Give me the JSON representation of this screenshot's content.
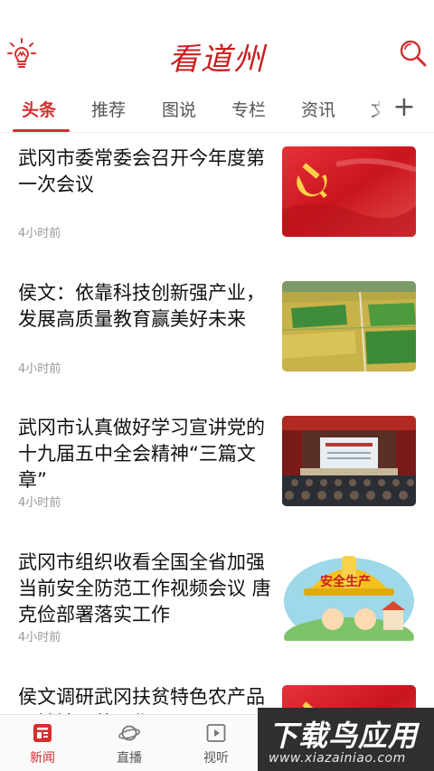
{
  "app": {
    "logo_text": "看道州",
    "brand_color": "#d32f2f"
  },
  "header": {
    "left_icon": "lightbulb-icon",
    "right_icon": "search-icon"
  },
  "tabs": {
    "items": [
      {
        "label": "头条",
        "active": true
      },
      {
        "label": "推荐",
        "active": false
      },
      {
        "label": "图说",
        "active": false
      },
      {
        "label": "专栏",
        "active": false
      },
      {
        "label": "资讯",
        "active": false
      },
      {
        "label": "文",
        "active": false
      }
    ],
    "add_label": "+"
  },
  "feed": {
    "articles": [
      {
        "title": "武冈市委常委会召开今年度第一次会议",
        "time": "4小时前",
        "image": "party-flag-image"
      },
      {
        "title": "侯文：依靠科技创新强产业，发展高质量教育赢美好未来",
        "time": "4小时前",
        "image": "farmland-aerial-image"
      },
      {
        "title": "武冈市认真做好学习宣讲党的十九届五中全会精神“三篇文章”",
        "time": "4小时前",
        "image": "conference-hall-image"
      },
      {
        "title": "武冈市组织收看全国全省加强当前安全防范工作视频会议 唐克俭部署落实工作",
        "time": "4小时前",
        "image": "safety-production-image",
        "image_text": "安全生产"
      },
      {
        "title": "侯文调研武冈扶贫特色农产品展销馆运营工作",
        "time": "",
        "image": "party-flag-image"
      }
    ]
  },
  "bottom_nav": {
    "items": [
      {
        "label": "新闻",
        "icon": "news-icon",
        "active": true
      },
      {
        "label": "直播",
        "icon": "planet-icon",
        "active": false
      },
      {
        "label": "视听",
        "icon": "play-icon",
        "active": false
      }
    ]
  },
  "watermark": {
    "main": "下载鸟应用",
    "sub": "www.xiazainiao.com"
  }
}
